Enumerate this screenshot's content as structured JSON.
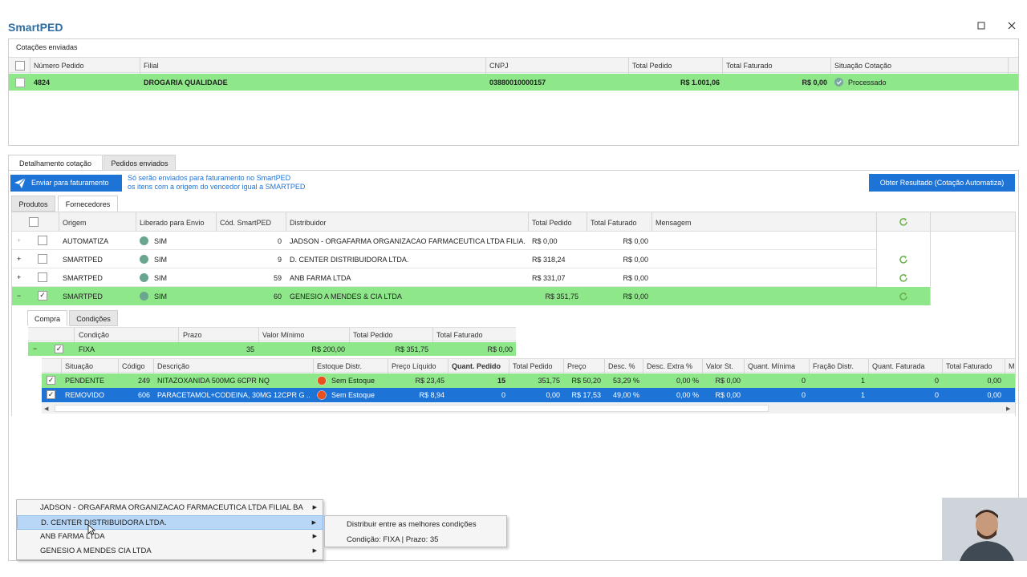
{
  "app": {
    "title": "SmartPED"
  },
  "window": {
    "maximize_icon": "maximize-icon",
    "close_icon": "close-icon"
  },
  "quotes": {
    "title": "Cotações enviadas",
    "headers": [
      "Número Pedido",
      "Filial",
      "CNPJ",
      "Total Pedido",
      "Total Faturado",
      "Situação Cotação"
    ],
    "row": {
      "numero": "4824",
      "filial": "DROGARIA QUALIDADE",
      "cnpj": "03880010000157",
      "total_pedido": "R$ 1.001,06",
      "total_faturado": "R$ 0,00",
      "situacao": "Processado"
    }
  },
  "tabs": {
    "detalhamento": "Detalhamento cotação",
    "pedidos": "Pedidos enviados"
  },
  "actions": {
    "send_label": "Enviar para faturamento",
    "info_line1": "Só serão enviados para faturamento no SmartPED",
    "info_line2": "os itens com a origem do vencedor igual a SMARTPED",
    "obter_label": "Obter Resultado (Cotação Automatiza)"
  },
  "subtabs": {
    "produtos": "Produtos",
    "fornecedores": "Fornecedores"
  },
  "suppliers": {
    "headers": [
      "Origem",
      "Liberado para Envio",
      "Cód. SmartPED",
      "Distribuidor",
      "Total Pedido",
      "Total Faturado",
      "Mensagem"
    ],
    "rows": [
      {
        "expander": "+",
        "origem": "AUTOMATIZA",
        "liberado": "SIM",
        "cod": "0",
        "distribuidor": "JADSON - ORGAFARMA ORGANIZACAO FARMACEUTICA LTDA FILIA...",
        "total": "R$ 0,00",
        "faturado": "R$ 0,00"
      },
      {
        "expander": "+",
        "origem": "SMARTPED",
        "liberado": "SIM",
        "cod": "9",
        "distribuidor": "D. CENTER DISTRIBUIDORA LTDA.",
        "total": "R$ 318,24",
        "faturado": "R$ 0,00"
      },
      {
        "expander": "+",
        "origem": "SMARTPED",
        "liberado": "SIM",
        "cod": "59",
        "distribuidor": "ANB FARMA LTDA",
        "total": "R$ 331,07",
        "faturado": "R$ 0,00"
      },
      {
        "expander": "−",
        "origem": "SMARTPED",
        "liberado": "SIM",
        "cod": "60",
        "distribuidor": "GENESIO A MENDES & CIA LTDA",
        "total": "R$ 351,75",
        "faturado": "R$ 0,00"
      }
    ]
  },
  "detail": {
    "tabs": {
      "compra": "Compra",
      "condicoes": "Condições"
    },
    "cond_headers": [
      "Condição",
      "Prazo",
      "Valor Mínimo",
      "Total Pedido",
      "Total Faturado"
    ],
    "cond_row": {
      "expander": "−",
      "condicao": "FIXA",
      "prazo": "35",
      "valor_minimo": "R$ 200,00",
      "total_pedido": "R$ 351,75",
      "total_faturado": "R$ 0,00"
    },
    "item_headers": [
      "Situação",
      "Código",
      "Descrição",
      "Estoque Distr.",
      "Preço Líquido",
      "Quant. Pedido",
      "Total Pedido",
      "Preço",
      "Desc. %",
      "Desc. Extra %",
      "Valor St.",
      "Quant. Mínima",
      "Fração Distr.",
      "Quant. Faturada",
      "Total Faturado",
      "M"
    ],
    "items": [
      {
        "situacao": "PENDENTE",
        "codigo": "249",
        "descricao": "NITAZOXANIDA 500MG 6CPR NQ",
        "estoque": "Sem Estoque",
        "preco_liq": "R$ 23,45",
        "quant": "15",
        "total": "351,75",
        "preco": "R$ 50,20",
        "desc": "53,29 %",
        "desc_extra": "0,00 %",
        "valor_st": "R$ 0,00",
        "quant_min": "0",
        "fracao": "1",
        "quant_fat": "0",
        "total_fat": "0,00"
      },
      {
        "situacao": "REMOVIDO",
        "codigo": "606",
        "descricao": "PARACETAMOL+CODEINA, 30MG 12CPR G ...",
        "estoque": "Sem Estoque",
        "preco_liq": "R$ 8,94",
        "quant": "0",
        "total": "0,00",
        "preco": "R$ 17,53",
        "desc": "49,00 %",
        "desc_extra": "0,00 %",
        "valor_st": "R$ 0,00",
        "quant_min": "0",
        "fracao": "1",
        "quant_fat": "0",
        "total_fat": "0,00"
      }
    ]
  },
  "context_menu": {
    "items": [
      {
        "label": "JADSON - ORGAFARMA ORGANIZACAO FARMACEUTICA LTDA FILIAL BA",
        "arrow": "▶"
      },
      {
        "label": "D. CENTER DISTRIBUIDORA LTDA.",
        "arrow": "▶"
      },
      {
        "label": "ANB FARMA LTDA",
        "arrow": "▶"
      },
      {
        "label": "GENESIO A MENDES  CIA LTDA",
        "arrow": "▶"
      }
    ],
    "submenu": {
      "item1": "Distribuir entre as melhores condições",
      "item2": "Condição: FIXA | Prazo: 35"
    }
  },
  "colors": {
    "green_row": "#8ee88a",
    "selected_row": "#1e73d6",
    "brand": "#2e6da4"
  }
}
